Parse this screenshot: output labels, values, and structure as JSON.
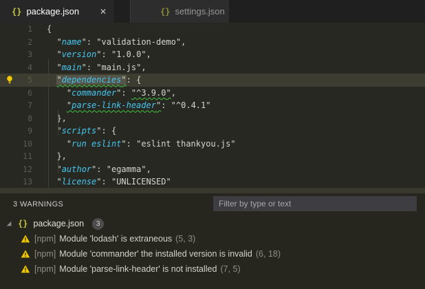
{
  "colors": {
    "key": "#44c7f0",
    "string": "#d6d6d0",
    "squiggle": "#3fc43f",
    "warning_icon": "#edc600",
    "json_icon": "#c3c542",
    "editor_background": "#282822",
    "current_line": "#3c3c31"
  },
  "icons": {
    "json_braces": "{}",
    "close": "✕"
  },
  "tabs": {
    "active": {
      "label": "package.json"
    },
    "inactive": {
      "label": "settings.json"
    }
  },
  "editor": {
    "lines": [
      {
        "n": 1,
        "tokens": [
          {
            "t": "p",
            "v": "{"
          }
        ]
      },
      {
        "n": 2,
        "tokens": [
          {
            "t": "p",
            "v": "  "
          },
          {
            "t": "k",
            "v": "name"
          },
          {
            "t": "p",
            "v": ": "
          },
          {
            "t": "s",
            "v": "validation-demo"
          },
          {
            "t": "p",
            "v": ","
          }
        ]
      },
      {
        "n": 3,
        "tokens": [
          {
            "t": "p",
            "v": "  "
          },
          {
            "t": "k",
            "v": "version"
          },
          {
            "t": "p",
            "v": ": "
          },
          {
            "t": "s",
            "v": "1.0.0"
          },
          {
            "t": "p",
            "v": ","
          }
        ]
      },
      {
        "n": 4,
        "tokens": [
          {
            "t": "p",
            "v": "  "
          },
          {
            "t": "k",
            "v": "main"
          },
          {
            "t": "p",
            "v": ": "
          },
          {
            "t": "s",
            "v": "main.js"
          },
          {
            "t": "p",
            "v": ","
          }
        ]
      },
      {
        "n": 5,
        "current": true,
        "lightbulb": true,
        "tokens": [
          {
            "t": "p",
            "v": "  "
          },
          {
            "t": "k",
            "v": "dependencies",
            "squiggle": true,
            "selected": true
          },
          {
            "t": "p",
            "v": ": {"
          }
        ]
      },
      {
        "n": 6,
        "tokens": [
          {
            "t": "p",
            "v": "    "
          },
          {
            "t": "k",
            "v": "commander"
          },
          {
            "t": "p",
            "v": ": "
          },
          {
            "t": "s",
            "v": "^3.9.0",
            "squiggle": true
          },
          {
            "t": "p",
            "v": ","
          }
        ]
      },
      {
        "n": 7,
        "tokens": [
          {
            "t": "p",
            "v": "    "
          },
          {
            "t": "k",
            "v": "parse-link-header",
            "squiggle": true
          },
          {
            "t": "p",
            "v": ": "
          },
          {
            "t": "s",
            "v": "^0.4.1"
          }
        ]
      },
      {
        "n": 8,
        "tokens": [
          {
            "t": "p",
            "v": "  },"
          }
        ]
      },
      {
        "n": 9,
        "tokens": [
          {
            "t": "p",
            "v": "  "
          },
          {
            "t": "k",
            "v": "scripts"
          },
          {
            "t": "p",
            "v": ": {"
          }
        ]
      },
      {
        "n": 10,
        "tokens": [
          {
            "t": "p",
            "v": "    "
          },
          {
            "t": "k",
            "v": "run eslint"
          },
          {
            "t": "p",
            "v": ": "
          },
          {
            "t": "s",
            "v": "eslint thankyou.js"
          }
        ]
      },
      {
        "n": 11,
        "tokens": [
          {
            "t": "p",
            "v": "  },"
          }
        ]
      },
      {
        "n": 12,
        "tokens": [
          {
            "t": "p",
            "v": "  "
          },
          {
            "t": "k",
            "v": "author"
          },
          {
            "t": "p",
            "v": ": "
          },
          {
            "t": "s",
            "v": "egamma"
          },
          {
            "t": "p",
            "v": ","
          }
        ]
      },
      {
        "n": 13,
        "tokens": [
          {
            "t": "p",
            "v": "  "
          },
          {
            "t": "k",
            "v": "license"
          },
          {
            "t": "p",
            "v": ": "
          },
          {
            "t": "s",
            "v": "UNLICENSED"
          }
        ]
      }
    ]
  },
  "panel": {
    "status_label": "3 WARNINGS",
    "filter_placeholder": "Filter by type or text",
    "file_group": {
      "name": "package.json",
      "badge": "3"
    },
    "warnings": [
      {
        "source": "[npm]",
        "message": "Module 'lodash' is extraneous",
        "location": "(5, 3)"
      },
      {
        "source": "[npm]",
        "message": "Module 'commander' the installed version is invalid",
        "location": "(6, 18)"
      },
      {
        "source": "[npm]",
        "message": "Module 'parse-link-header' is not installed",
        "location": "(7, 5)"
      }
    ]
  }
}
